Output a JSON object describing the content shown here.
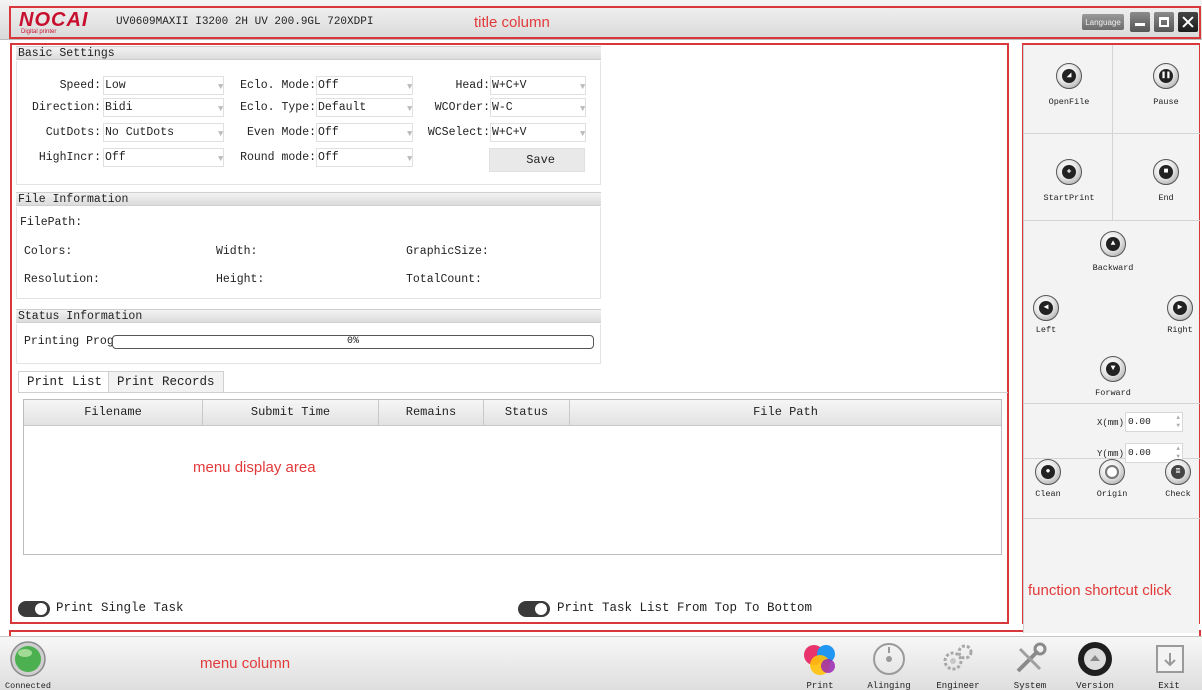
{
  "window": {
    "logo_text": "NOCAI",
    "logo_tag": "Digital printer",
    "title": "UV0609MAXII I3200 2H UV 200.9GL 720XDPI",
    "language_label": "Language"
  },
  "annotations": {
    "title_column": "title column",
    "menu_display_area": "menu display area",
    "function_shortcut_click": "function shortcut click",
    "menu_column": "menu column"
  },
  "basic_settings": {
    "header": "Basic Settings",
    "fields": [
      {
        "label": "Speed:",
        "value": "Low"
      },
      {
        "label": "Eclo. Mode:",
        "value": "Off"
      },
      {
        "label": "Head:",
        "value": "W+C+V"
      },
      {
        "label": "Direction:",
        "value": "Bidi"
      },
      {
        "label": "Eclo. Type:",
        "value": "Default"
      },
      {
        "label": "WCOrder:",
        "value": "W-C"
      },
      {
        "label": "CutDots:",
        "value": "No CutDots"
      },
      {
        "label": "Even Mode:",
        "value": "Off"
      },
      {
        "label": "WCSelect:",
        "value": "W+C+V"
      },
      {
        "label": "HighIncr:",
        "value": "Off"
      },
      {
        "label": "Round mode:",
        "value": "Off"
      }
    ],
    "save_label": "Save"
  },
  "file_information": {
    "header": "File Information",
    "file_path_label": "FilePath:",
    "colors_label": "Colors:",
    "width_label": "Width:",
    "graphic_size_label": "GraphicSize:",
    "resolution_label": "Resolution:",
    "height_label": "Height:",
    "total_count_label": "TotalCount:"
  },
  "status_information": {
    "header": "Status Information",
    "printing_progress_label": "Printing Prog",
    "progress_text": "0%",
    "progress_fraction": 0
  },
  "tabs": [
    "Print List",
    "Print Records"
  ],
  "table": {
    "columns": [
      "Filename",
      "Submit Time",
      "Remains",
      "Status",
      "File Path"
    ],
    "rows": []
  },
  "options": {
    "single_task": "Print Single Task",
    "top_to_bottom": "Print Task List From Top To Bottom"
  },
  "shortcuts": {
    "open_file": "OpenFile",
    "pause": "Pause",
    "start_print": "StartPrint",
    "end": "End",
    "backward": "Backward",
    "left": "Left",
    "right": "Right",
    "forward": "Forward",
    "x_label": "X(mm)",
    "x_value": "0.00",
    "y_label": "Y(mm)",
    "y_value": "0.00",
    "clean": "Clean",
    "origin": "Origin",
    "check": "Check"
  },
  "menu": {
    "connected": "Connected",
    "print": "Print",
    "aligning": "Alinging",
    "engineer": "Engineer",
    "system": "System",
    "version": "Version",
    "exit": "Exit"
  },
  "colors": {
    "annotation_red": "#d9383a",
    "logo_red": "#c8102e",
    "connected_green": "#4caf50"
  }
}
